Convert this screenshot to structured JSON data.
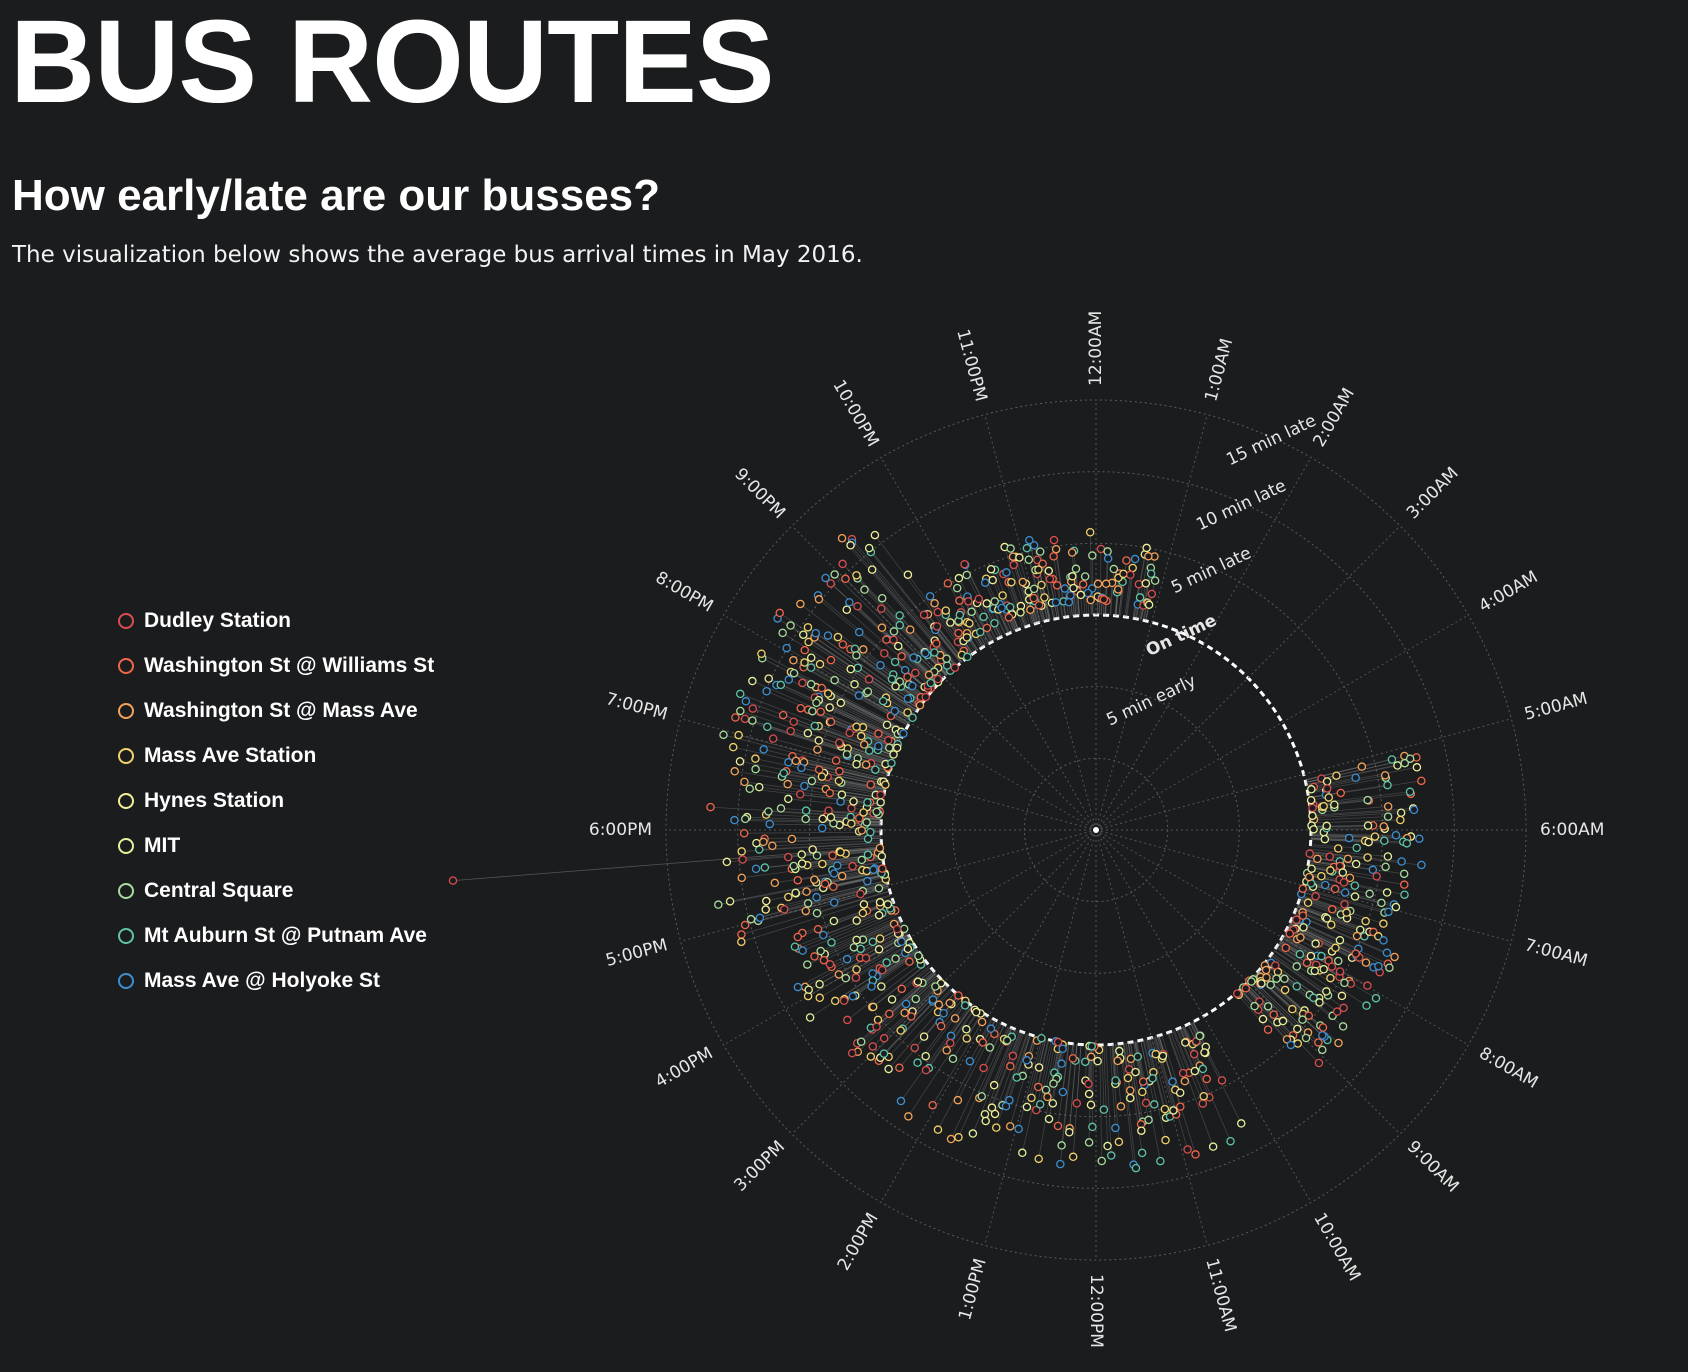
{
  "header": {
    "title": "BUS ROUTES",
    "subtitle": "How early/late are our busses?",
    "description": "The visualization below shows the average bus arrival times in May 2016."
  },
  "legend": {
    "items": [
      {
        "label": "Dudley Station",
        "color": "#d94e4e"
      },
      {
        "label": "Washington St @ Williams St",
        "color": "#f0664b"
      },
      {
        "label": "Washington St @ Mass Ave",
        "color": "#f5a35a"
      },
      {
        "label": "Mass Ave Station",
        "color": "#f2d26a"
      },
      {
        "label": "Hynes Station",
        "color": "#f4f09a"
      },
      {
        "label": "MIT",
        "color": "#e4f29a"
      },
      {
        "label": "Central Square",
        "color": "#a8dc9c"
      },
      {
        "label": "Mt Auburn St @ Putnam Ave",
        "color": "#5fc4a8"
      },
      {
        "label": "Mass Ave @ Holyoke St",
        "color": "#3d8fd0"
      }
    ]
  },
  "chart_data": {
    "type": "scatter",
    "projection": "polar",
    "angular_axis": {
      "unit": "hour of day",
      "tick_labels": [
        "12:00AM",
        "1:00AM",
        "2:00AM",
        "3:00AM",
        "4:00AM",
        "5:00AM",
        "6:00AM",
        "7:00AM",
        "8:00AM",
        "9:00AM",
        "10:00AM",
        "11:00AM",
        "12:00PM",
        "1:00PM",
        "2:00PM",
        "3:00PM",
        "4:00PM",
        "5:00PM",
        "6:00PM",
        "7:00PM",
        "8:00PM",
        "9:00PM",
        "10:00PM",
        "11:00PM"
      ],
      "direction": "clockwise",
      "zero_at": "top"
    },
    "radial_axis": {
      "unit": "minutes late",
      "range": [
        -15,
        15
      ],
      "ticks": [
        -10,
        -5,
        0,
        5,
        10,
        15
      ],
      "tick_labels": {
        "-5": "5 min early",
        "0": "On time",
        "5": "5 min late",
        "10": "10 min late",
        "15": "15 min late"
      },
      "highlight": 0
    },
    "grid": true,
    "legend_position": "left",
    "series_note": "",
    "clusters": [
      {
        "hour_from": 5.1,
        "hour_to": 9.3,
        "delay_from": 0,
        "delay_to": 8,
        "count": 260
      },
      {
        "hour_from": 10.2,
        "hour_to": 11.5,
        "delay_from": 1,
        "delay_to": 9,
        "count": 60
      },
      {
        "hour_from": 11.5,
        "hour_to": 16.8,
        "delay_from": 0,
        "delay_to": 9,
        "count": 250
      },
      {
        "hour_from": 16.8,
        "hour_to": 21.6,
        "delay_from": 0,
        "delay_to": 12,
        "count": 380
      },
      {
        "hour_from": 21.6,
        "hour_to": 24.0,
        "delay_from": 1,
        "delay_to": 6,
        "count": 120
      },
      {
        "hour_from": 0.0,
        "hour_to": 0.9,
        "delay_from": 1,
        "delay_to": 5,
        "count": 40
      }
    ],
    "outliers": [
      {
        "hour": 17.7,
        "delay": 30,
        "series": "Dudley Station"
      }
    ]
  }
}
